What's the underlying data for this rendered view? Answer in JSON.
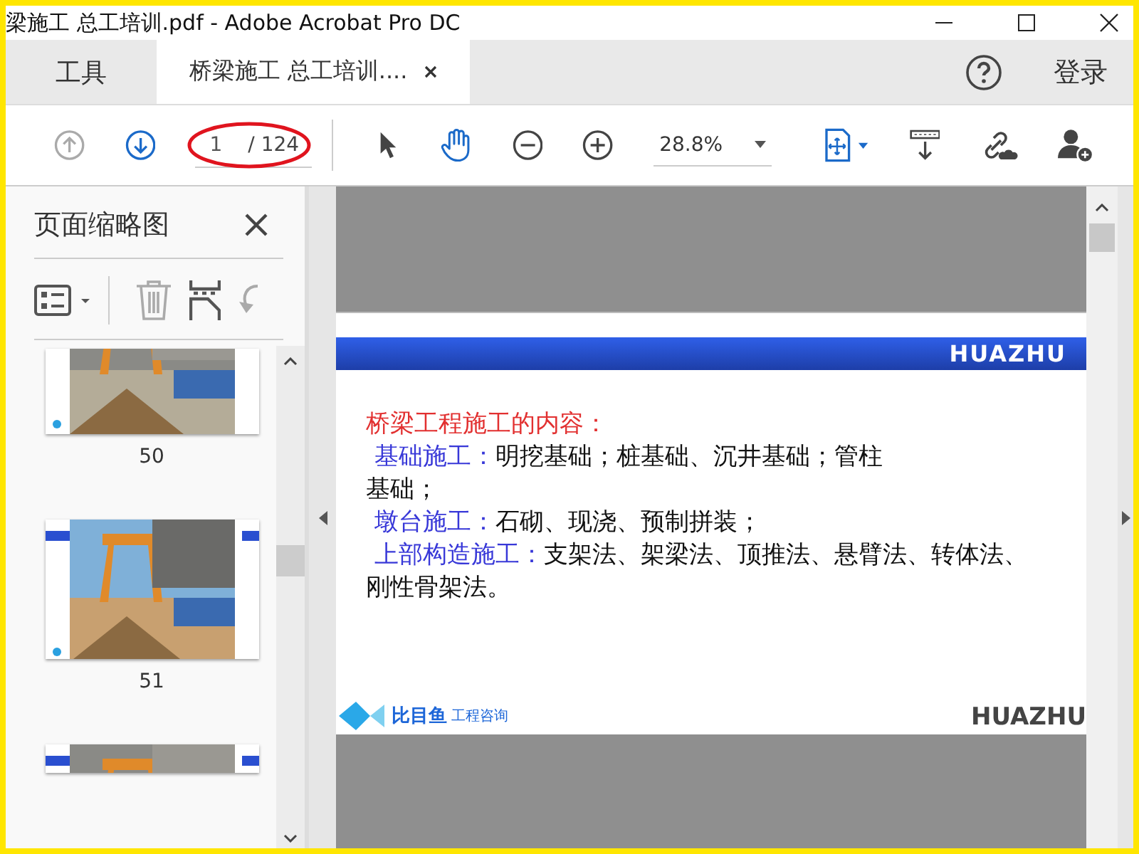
{
  "window": {
    "title": "梁施工 总工培训.pdf - Adobe Acrobat Pro DC"
  },
  "tabs": [
    {
      "label": "工具",
      "selected": false
    },
    {
      "label": "桥梁施工 总工培训....",
      "selected": true
    }
  ],
  "account": {
    "login": "登录"
  },
  "toolbar": {
    "page_value": "1",
    "page_total": "/ 124",
    "zoom": "28.8%"
  },
  "thumbnails_panel": {
    "title": "页面缩略图",
    "thumbnails": [
      {
        "label": "50",
        "kind": "cut-top"
      },
      {
        "label": "51",
        "kind": "full"
      },
      {
        "kind": "cut-bottom"
      }
    ]
  },
  "slide": {
    "header_logo": "HUAZHU",
    "heading": "桥梁工程施工的内容：",
    "lines": [
      {
        "label": "基础施工：",
        "text": "明挖基础；桩基础、沉井基础；管柱"
      },
      {
        "text": "基础；"
      },
      {
        "label": "墩台施工：",
        "text": "石砌、现浇、预制拼装；"
      },
      {
        "label": "上部构造施工：",
        "text": "支架法、架梁法、顶推法、悬臂法、转体法、"
      },
      {
        "text": "刚性骨架法。"
      }
    ],
    "footer_brand": "比目鱼",
    "footer_brand_suffix": "工程咨询",
    "footer_logo": "HUAZHU"
  }
}
